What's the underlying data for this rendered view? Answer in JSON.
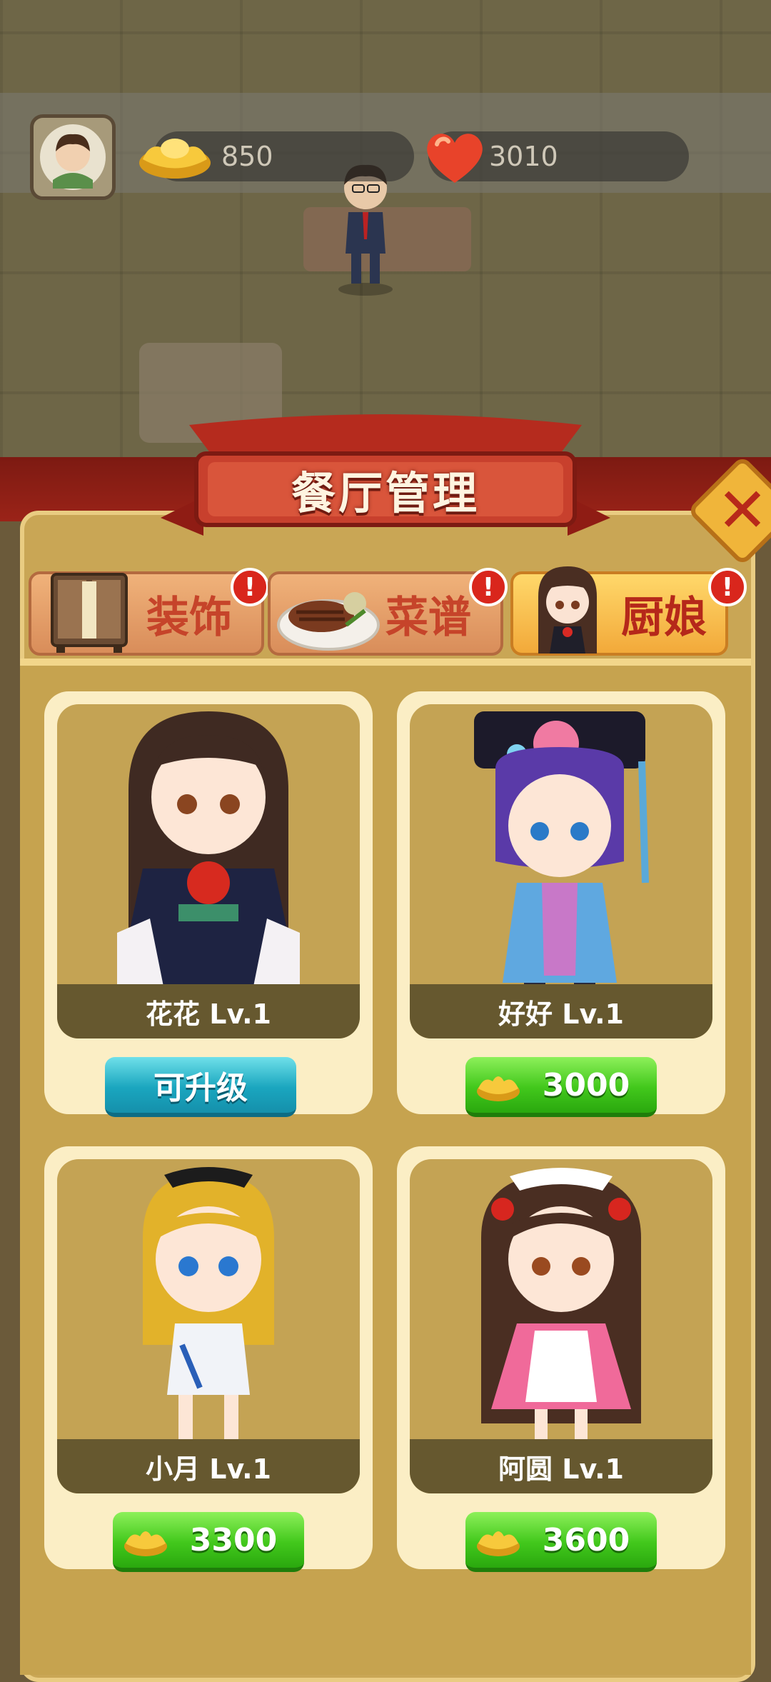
{
  "hud": {
    "gold_amount": "850",
    "heart_amount": "3010",
    "gold_icon": "gold-ingot-icon",
    "heart_icon": "heart-icon"
  },
  "panel": {
    "title": "餐厅管理",
    "close_icon": "close-icon"
  },
  "tabs": [
    {
      "label": "装饰",
      "badge": "!",
      "selected": false
    },
    {
      "label": "菜谱",
      "badge": "!",
      "selected": false
    },
    {
      "label": "厨娘",
      "badge": "!",
      "selected": true
    }
  ],
  "chefs": [
    {
      "name_level": "花花 Lv.1",
      "action": "可升级",
      "action_type": "upgrade"
    },
    {
      "name_level": "好好 Lv.1",
      "action": "3000",
      "action_type": "buy"
    },
    {
      "name_level": "小月 Lv.1",
      "action": "3300",
      "action_type": "buy"
    },
    {
      "name_level": "阿圆 Lv.1",
      "action": "3600",
      "action_type": "buy"
    }
  ],
  "colors": {
    "panel": "#c9a655",
    "card": "#fbeec5",
    "upgrade_button": "#1aa6bf",
    "buy_button": "#42c81c",
    "title_banner": "#c23a2b"
  }
}
